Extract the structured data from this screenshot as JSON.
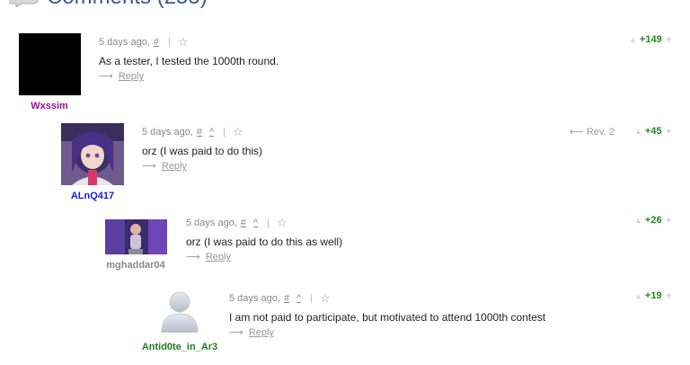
{
  "header": {
    "title": "Comments (255)",
    "icon": "comment-bubble-icon"
  },
  "comments": [
    {
      "handle": "Wxssim",
      "handle_color": "#9b0e9b",
      "time": "5 days ago,",
      "permalink": "#",
      "text": "As a tester, I tested the 1000th round.",
      "reply": "Reply",
      "score": "+149",
      "avatar": "black-square"
    },
    {
      "handle": "ALnQ417",
      "handle_color": "#1a1adc",
      "time": "5 days ago,",
      "permalink": "#",
      "parent_link": "^",
      "text": "orz (I was paid to do this)",
      "reply": "Reply",
      "revision": "Rev. 2",
      "score": "+45",
      "avatar": "anime-portrait"
    },
    {
      "handle": "mghaddar04",
      "handle_color": "#888888",
      "time": "5 days ago,",
      "permalink": "#",
      "parent_link": "^",
      "text": "orz (I was paid to do this as well)",
      "reply": "Reply",
      "score": "+26",
      "avatar": "figure-photo"
    },
    {
      "handle": "Antid0te_in_Ar3",
      "handle_color": "#1f7a1f",
      "time": "5 days ago,",
      "permalink": "#",
      "parent_link": "^",
      "text": "I am not paid to participate, but motivated to attend 1000th contest",
      "reply": "Reply",
      "score": "+19",
      "avatar": "default-user"
    }
  ],
  "icons": {
    "star": "☆",
    "reply_arrow": "⟶",
    "rev_arrow": "⟵",
    "vote_up": "▲",
    "vote_down": "▼",
    "separator": "|"
  }
}
